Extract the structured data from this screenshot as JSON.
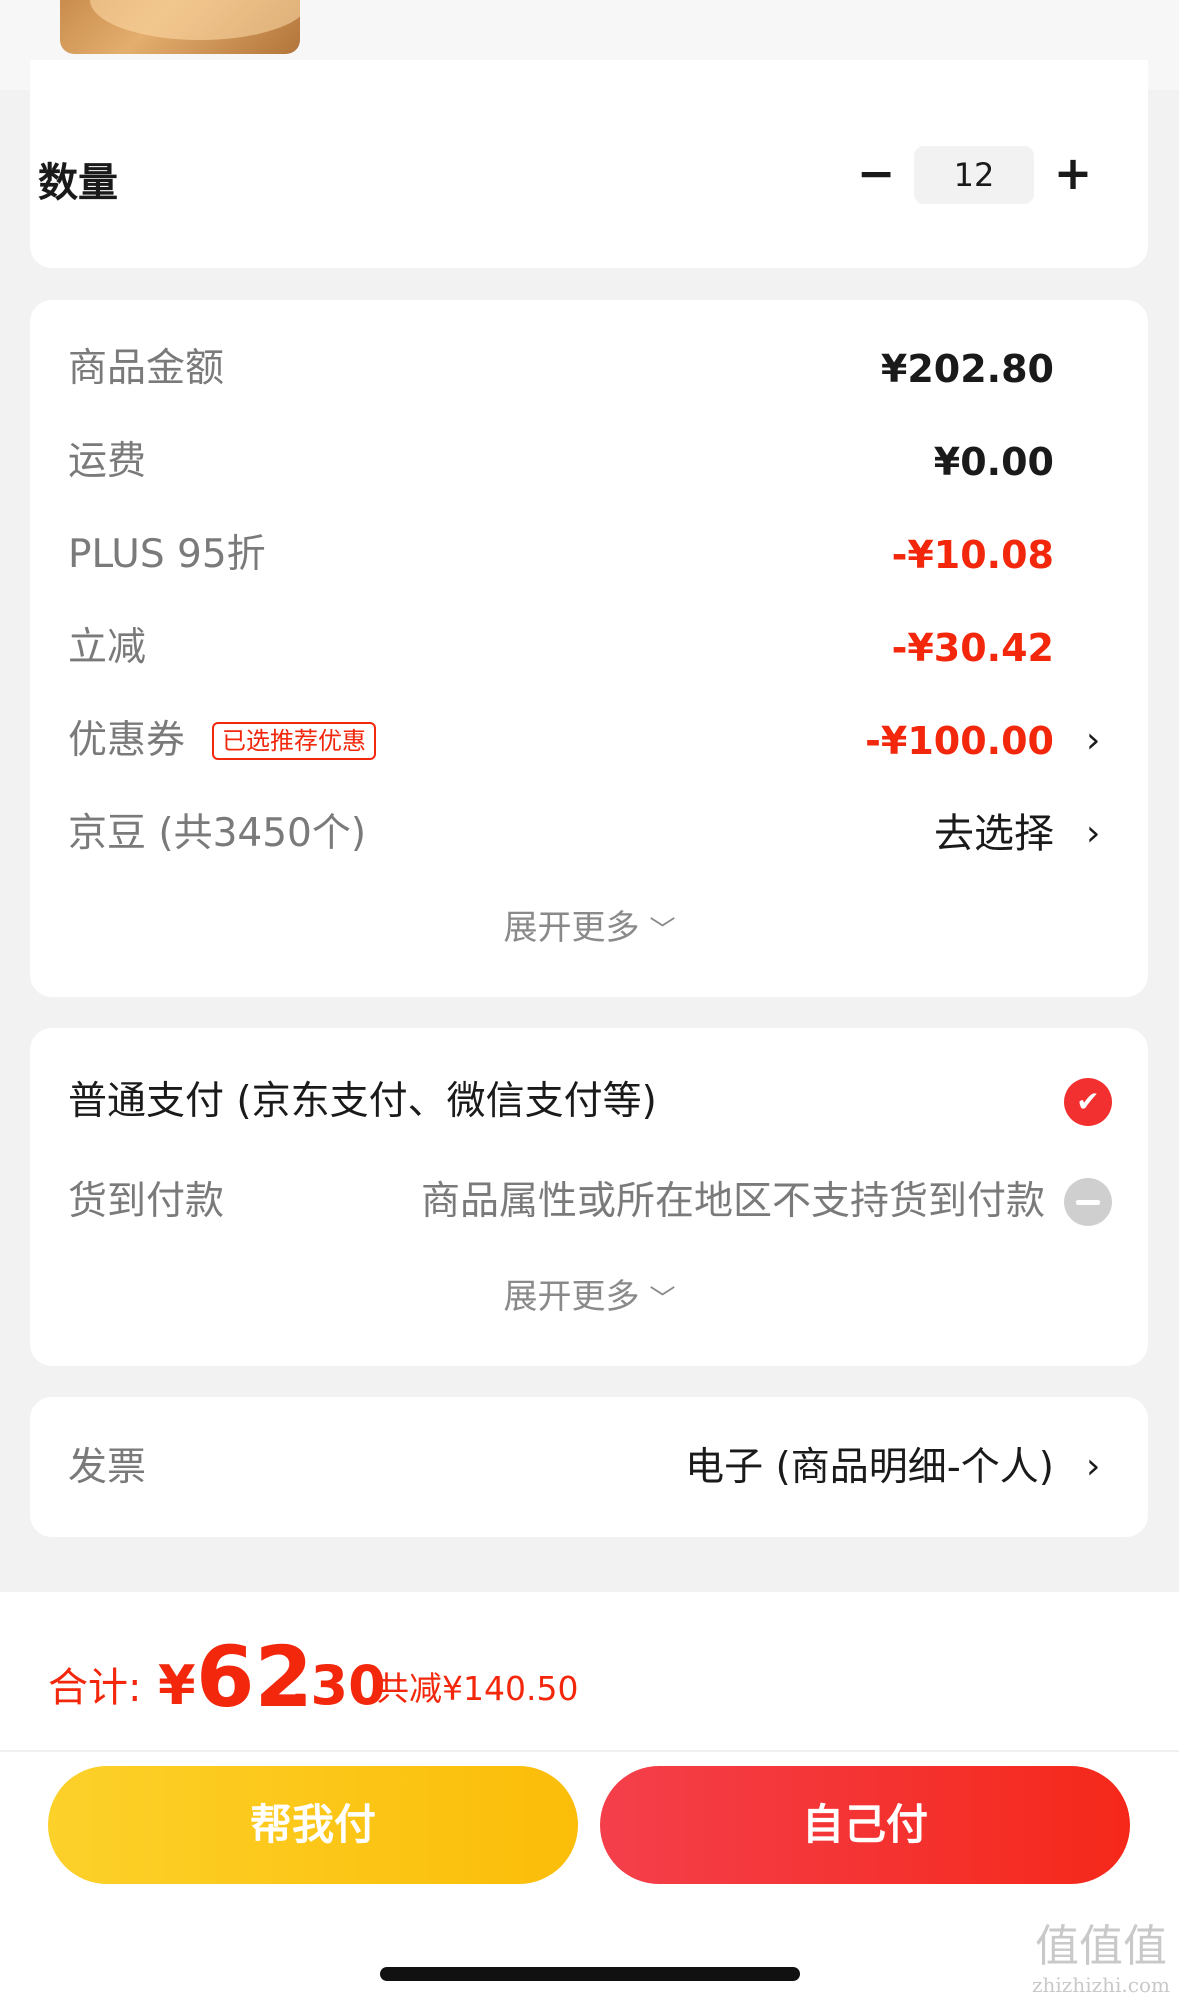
{
  "quantity": {
    "label": "数量",
    "minus": "−",
    "value": "12",
    "plus": "+"
  },
  "amounts": {
    "rows": [
      {
        "label": "商品金额",
        "value": "¥202.80"
      },
      {
        "label": "运费",
        "value": "¥0.00"
      },
      {
        "label": "PLUS 95折",
        "value": "-¥10.08"
      },
      {
        "label": "立减",
        "value": "-¥30.42"
      },
      {
        "label": "优惠券",
        "value": "-¥100.00"
      },
      {
        "label": "京豆 (共3450个)",
        "value": "去选择"
      }
    ],
    "coupon_badge": "已选推荐优惠",
    "expand_more": "展开更多",
    "chevron": "›"
  },
  "payment": {
    "normal": "普通支付 (京东支付、微信支付等)",
    "normal_check": "✔",
    "cod": "货到付款",
    "cod_note": "商品属性或所在地区不支持货到付款",
    "expand_more": "展开更多"
  },
  "invoice": {
    "label": "发票",
    "value": "电子 (商品明细-个人)"
  },
  "total": {
    "label": "合计:",
    "currency": "¥",
    "integer": "62",
    "decimal": ".30",
    "saved": "共减¥140.50"
  },
  "buttons": {
    "help_pay": "帮我付",
    "self_pay": "自己付"
  },
  "watermark": {
    "logo": "值值值",
    "url": "zhizhizhi.com"
  },
  "colors": {
    "accent_red": "#f2270c",
    "help_yellow": "#fbbd08"
  }
}
